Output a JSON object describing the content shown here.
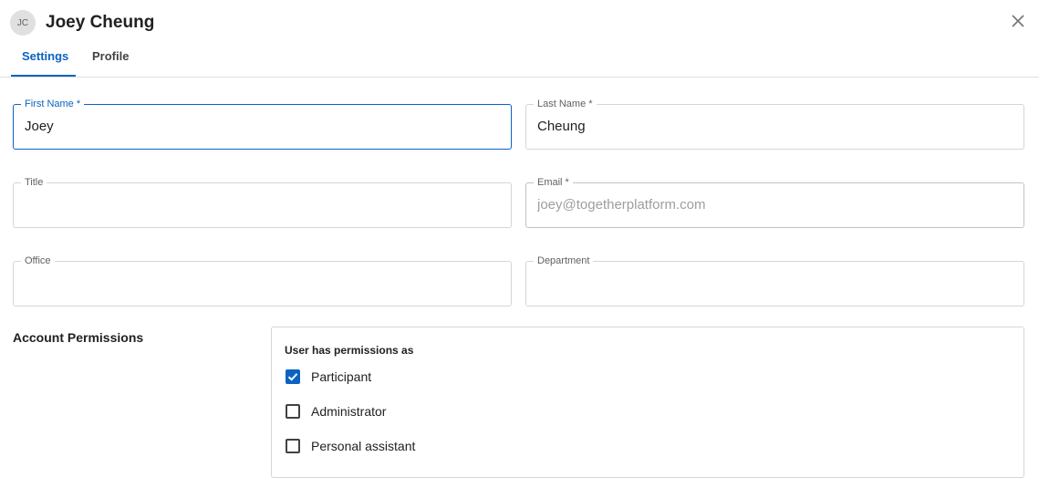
{
  "header": {
    "avatar_initials": "JC",
    "user_name": "Joey Cheung"
  },
  "tabs": [
    {
      "label": "Settings",
      "active": true
    },
    {
      "label": "Profile",
      "active": false
    }
  ],
  "form": {
    "first_name": {
      "label": "First Name *",
      "value": "Joey"
    },
    "last_name": {
      "label": "Last Name *",
      "value": "Cheung"
    },
    "title": {
      "label": "Title",
      "value": ""
    },
    "email": {
      "label": "Email *",
      "value": "joey@togetherplatform.com"
    },
    "office": {
      "label": "Office",
      "value": ""
    },
    "department": {
      "label": "Department",
      "value": ""
    }
  },
  "permissions": {
    "section_title": "Account Permissions",
    "heading": "User has permissions as",
    "options": [
      {
        "label": "Participant",
        "checked": true
      },
      {
        "label": "Administrator",
        "checked": false
      },
      {
        "label": "Personal assistant",
        "checked": false
      }
    ]
  },
  "colors": {
    "accent": "#0b63c1",
    "border": "#d6d6d6",
    "text": "#212121"
  }
}
